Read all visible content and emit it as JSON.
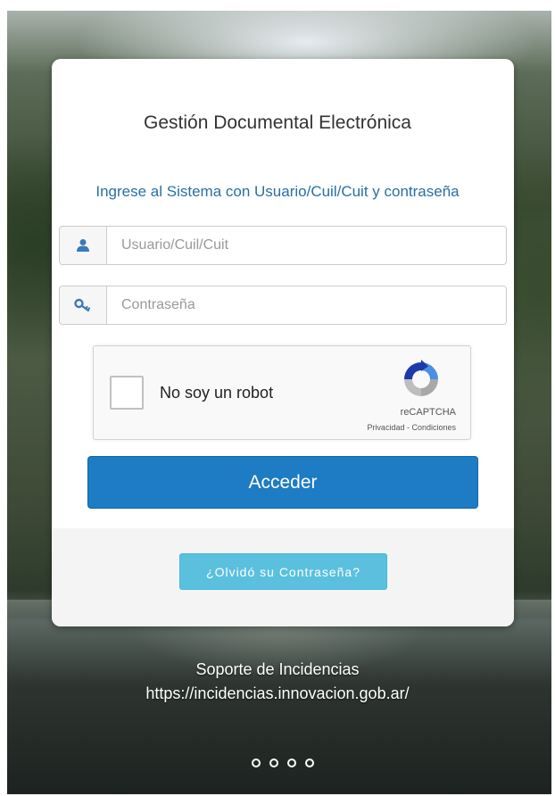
{
  "login": {
    "title": "Gestión Documental Electrónica",
    "subtitle": "Ingrese al Sistema con Usuario/Cuil/Cuit y contraseña",
    "username": {
      "placeholder": "Usuario/Cuil/Cuit",
      "value": "",
      "icon": "user-icon"
    },
    "password": {
      "placeholder": "Contraseña",
      "value": "",
      "icon": "key-icon"
    },
    "captcha": {
      "label": "No soy un robot",
      "brand": "reCAPTCHA",
      "privacy": "Privacidad",
      "separator": " - ",
      "terms": "Condiciones",
      "checked": false
    },
    "submit_label": "Acceder",
    "forgot_label": "¿Olvidó su Contraseña?"
  },
  "support": {
    "title": "Soporte de Incidencias",
    "url": "https://incidencias.innovacion.gob.ar/"
  },
  "carousel": {
    "slides": 4
  },
  "colors": {
    "primary": "#1d7cc4",
    "info": "#5bc0de",
    "subtitle": "#2a6fa5",
    "icon": "#3a7ab8"
  }
}
